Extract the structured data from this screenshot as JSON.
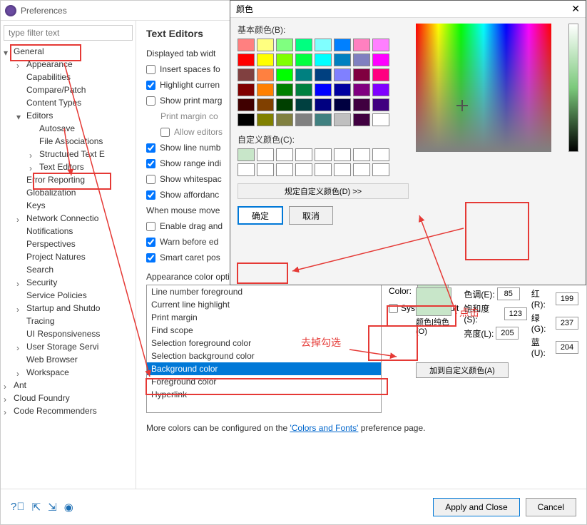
{
  "pref": {
    "title": "Preferences",
    "filter_placeholder": "type filter text",
    "tree0": "General",
    "tree0_0": "Appearance",
    "tree0_1": "Capabilities",
    "tree0_2": "Compare/Patch",
    "tree0_3": "Content Types",
    "tree0_4": "Editors",
    "tree0_4_0": "Autosave",
    "tree0_4_1": "File Associations",
    "tree0_4_2": "Structured Text E",
    "tree0_4_3": "Text Editors",
    "tree0_5": "Error Reporting",
    "tree0_6": "Globalization",
    "tree0_7": "Keys",
    "tree0_8": "Network Connectio",
    "tree0_9": "Notifications",
    "tree0_10": "Perspectives",
    "tree0_11": "Project Natures",
    "tree0_12": "Search",
    "tree0_13": "Security",
    "tree0_14": "Service Policies",
    "tree0_15": "Startup and Shutdo",
    "tree0_16": "Tracing",
    "tree0_17": "UI Responsiveness",
    "tree0_18": "User Storage Servi",
    "tree0_19": "Web Browser",
    "tree0_20": "Workspace",
    "tree1": "Ant",
    "tree2": "Cloud Foundry",
    "tree3": "Code Recommenders"
  },
  "content": {
    "title": "Text Editors",
    "displayed_tab": "Displayed tab widt",
    "insert_spaces": "Insert spaces fo",
    "highlight_current": "Highlight curren",
    "show_print_marg": "Show print marg",
    "print_margin_co": "Print margin co",
    "allow_editors": "Allow editors",
    "show_line_numb": "Show line numb",
    "show_range_indi": "Show range indi",
    "show_whitespac": "Show whitespac",
    "show_affordanc": "Show affordanc",
    "when_mouse_move": "When mouse move",
    "enable_drag_and": "Enable drag and",
    "warn_before_ed": "Warn before ed",
    "smart_caret_pos": "Smart caret pos",
    "appearance_label": "Appearance color options:",
    "clist0": "Line number foreground",
    "clist1": "Current line highlight",
    "clist2": "Print margin",
    "clist3": "Find scope",
    "clist4": "Selection foreground color",
    "clist5": "Selection background color",
    "clist6": "Background color",
    "clist7": "Foreground color",
    "clist8": "Hyperlink",
    "color_label": "Color:",
    "system_default": "System Default",
    "more_colors_pre": "More colors can be configured on the ",
    "more_colors_link": "'Colors and Fonts'",
    "more_colors_post": " preference page.",
    "apply_close": "Apply and Close",
    "cancel": "Cancel"
  },
  "color_dialog": {
    "title": "颜色",
    "basic_label": "基本颜色(B):",
    "custom_label": "自定义颜色(C):",
    "define_custom": "规定自定义颜色(D) >>",
    "ok": "确定",
    "cancel": "取消",
    "preview_label": "颜色|纯色(O)",
    "add_custom": "加到自定义颜色(A)",
    "hue_label": "色调(E):",
    "sat_label": "饱和度(S):",
    "lum_label": "亮度(L):",
    "r_label": "红(R):",
    "g_label": "绿(G):",
    "b_label": "蓝(U):",
    "hue_val": "85",
    "sat_val": "123",
    "lum_val": "205",
    "r_val": "199",
    "g_val": "237",
    "b_val": "204",
    "basic_colors": [
      "#ff8080",
      "#ffff80",
      "#80ff80",
      "#00ff80",
      "#80ffff",
      "#0080ff",
      "#ff80c0",
      "#ff80ff",
      "#ff0000",
      "#ffff00",
      "#80ff00",
      "#00ff40",
      "#00ffff",
      "#0080c0",
      "#8080c0",
      "#ff00ff",
      "#804040",
      "#ff8040",
      "#00ff00",
      "#008080",
      "#004080",
      "#8080ff",
      "#800040",
      "#ff0080",
      "#800000",
      "#ff8000",
      "#008000",
      "#008040",
      "#0000ff",
      "#0000a0",
      "#800080",
      "#8000ff",
      "#400000",
      "#804000",
      "#004000",
      "#004040",
      "#000080",
      "#000040",
      "#400040",
      "#400080",
      "#000000",
      "#808000",
      "#808040",
      "#808080",
      "#408080",
      "#c0c0c0",
      "#400040",
      "#ffffff"
    ]
  },
  "annotations": {
    "click": "点击",
    "uncheck": "去掉勾选"
  }
}
